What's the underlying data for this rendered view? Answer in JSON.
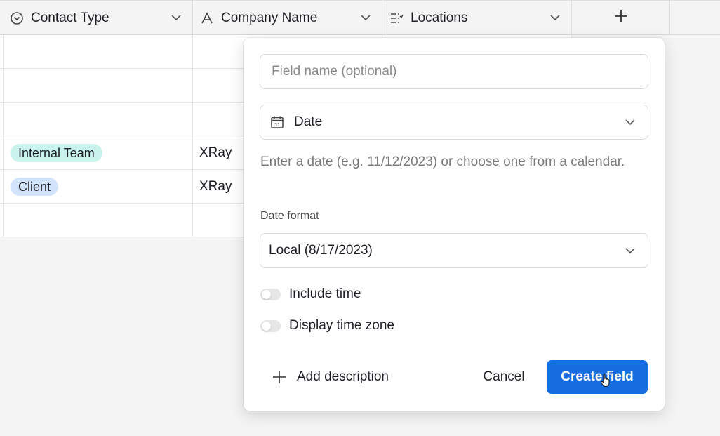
{
  "columns": [
    {
      "label": "Contact Type",
      "icon": "single-select-icon"
    },
    {
      "label": "Company Name",
      "icon": "text-field-icon"
    },
    {
      "label": "Locations",
      "icon": "multi-select-list-icon"
    }
  ],
  "add_column_icon": "plus-icon",
  "rows": [
    {
      "contact_type": "",
      "company": ""
    },
    {
      "contact_type": "",
      "company": ""
    },
    {
      "contact_type": "",
      "company": ""
    },
    {
      "contact_type": "Internal Team",
      "company": "XRay",
      "pill_color": "#c9f3ec"
    },
    {
      "contact_type": "Client",
      "company": "XRay",
      "pill_color": "#d2e4fb"
    },
    {
      "contact_type": "",
      "company": ""
    }
  ],
  "popover": {
    "field_name_placeholder": "Field name (optional)",
    "field_type": "Date",
    "description": "Enter a date (e.g. 11/12/2023) or choose one from a calendar.",
    "date_format_label": "Date format",
    "date_format_value": "Local (8/17/2023)",
    "include_time_label": "Include time",
    "include_time_on": false,
    "display_timezone_label": "Display time zone",
    "display_timezone_on": false,
    "add_description_label": "Add description",
    "cancel_label": "Cancel",
    "create_label": "Create field"
  },
  "colors": {
    "primary": "#166ee1",
    "pill_teal": "#c9f3ec",
    "pill_blue": "#d2e4fb"
  }
}
